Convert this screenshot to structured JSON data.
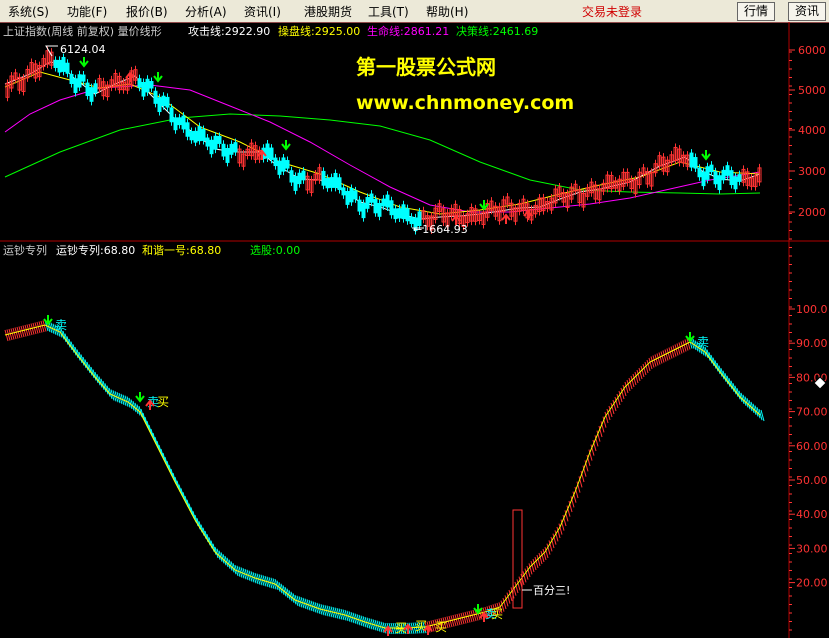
{
  "menu": {
    "items": [
      "系统(S)",
      "功能(F)",
      "报价(B)",
      "分析(A)",
      "资讯(I)",
      "港股期货",
      "工具(T)",
      "帮助(H)"
    ],
    "login_status": "交易未登录",
    "quote_button": "行情",
    "news_button": "资讯"
  },
  "top_panel": {
    "title": "上证指数(周线 前复权) 量价线形",
    "indicators": [
      {
        "label": "攻击线:",
        "value": "2922.90",
        "color": "#ffffff"
      },
      {
        "label": "操盘线:",
        "value": "2925.00",
        "color": "#ffff00"
      },
      {
        "label": "生命线:",
        "value": "2861.21",
        "color": "#ff00ff"
      },
      {
        "label": "决策线:",
        "value": "2461.69",
        "color": "#00ff00"
      }
    ],
    "high_label": "6124.04",
    "low_label": "1664.93",
    "watermark_title": "第一股票公式网",
    "watermark_url": "www.chnmoney.com",
    "y_ticks": [
      "6000",
      "5000",
      "4000",
      "3000",
      "2000"
    ]
  },
  "bottom_panel": {
    "name": "运钞专列",
    "line1": "运钞专列:68.80",
    "line2": "和谐一号:68.80",
    "line3": "选股:0.00",
    "y_ticks": [
      "100.0",
      "90.00",
      "80.00",
      "70.00",
      "60.00",
      "50.00",
      "40.00",
      "30.00",
      "20.00"
    ],
    "sell_label": "卖",
    "buy_label": "买",
    "percent_label": "百分三!"
  },
  "colors": {
    "axis_red": "#ff3333",
    "up_candle": "#ff3333",
    "down_candle": "#00ffff",
    "life_line": "#ff00ff",
    "decision_line": "#00ff00",
    "watermark_yellow": "#ffff00"
  }
}
